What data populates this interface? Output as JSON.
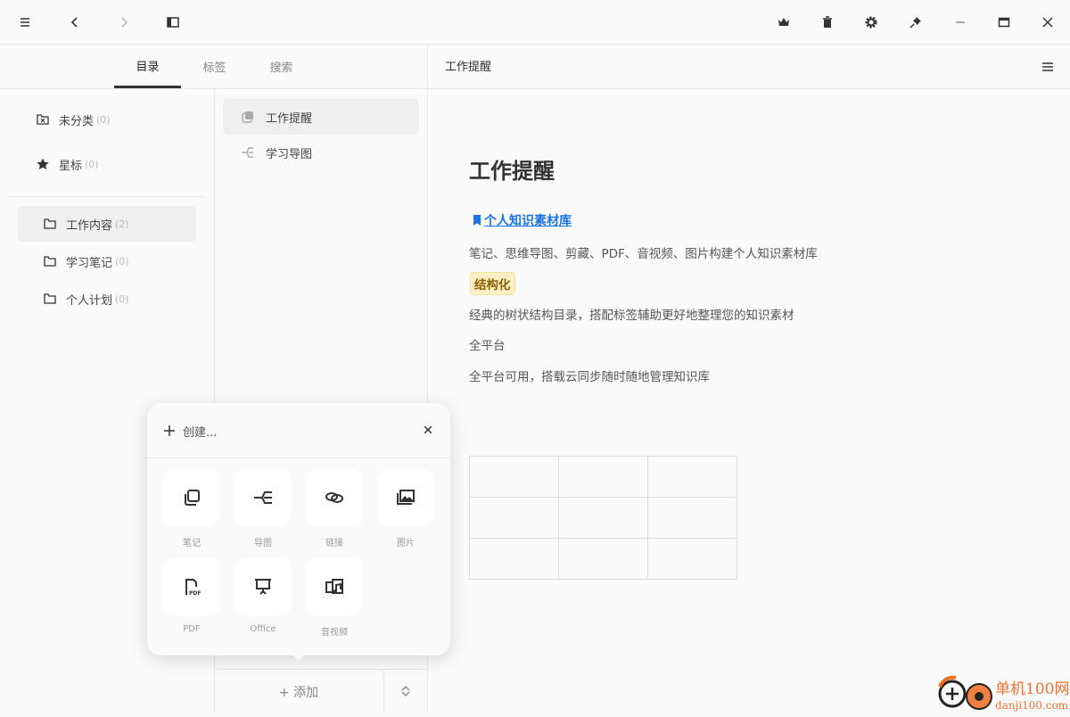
{
  "titlebar": {
    "icons": [
      "menu-icon",
      "back-icon",
      "forward-icon",
      "sidebar-toggle-icon",
      "crown-icon",
      "trash-icon",
      "settings-icon",
      "pin-icon",
      "minimize-icon",
      "maximize-icon",
      "close-icon"
    ]
  },
  "tabs": [
    {
      "label": "目录"
    },
    {
      "label": "标签"
    },
    {
      "label": "搜索"
    }
  ],
  "sidebar": {
    "special": [
      {
        "label": "未分类",
        "count": "(0)"
      },
      {
        "label": "星标",
        "count": "(0)"
      }
    ],
    "folders": [
      {
        "label": "工作内容",
        "count": "(2)"
      },
      {
        "label": "学习笔记",
        "count": "(0)"
      },
      {
        "label": "个人计划",
        "count": "(0)"
      }
    ]
  },
  "notes": [
    {
      "label": "工作提醒"
    },
    {
      "label": "学习导图"
    }
  ],
  "list_footer": {
    "add_label": "+ 添加"
  },
  "editor": {
    "header_title": "工作提醒",
    "title": "工作提醒",
    "link": "个人知识素材库",
    "p1": "笔记、思维导图、剪藏、PDF、音视频、图片构建个人知识素材库",
    "highlight": "结构化",
    "p2": "经典的树状结构目录，搭配标签辅助更好地整理您的知识素材",
    "p3": "全平台",
    "p4": "全平台可用，搭载云同步随时随地管理知识库",
    "link_color": "#1a73e8",
    "highlight_bg": "#fdf0c4",
    "highlight_color": "#8a6000"
  },
  "popup": {
    "title": "创建...",
    "items": [
      {
        "label": "笔记"
      },
      {
        "label": "导图"
      },
      {
        "label": "链接"
      },
      {
        "label": "图片"
      },
      {
        "label": "PDF"
      },
      {
        "label": "Office"
      },
      {
        "label": "音视频"
      }
    ]
  },
  "watermark": {
    "text": "单机100网",
    "url_text": "danji100.com"
  }
}
